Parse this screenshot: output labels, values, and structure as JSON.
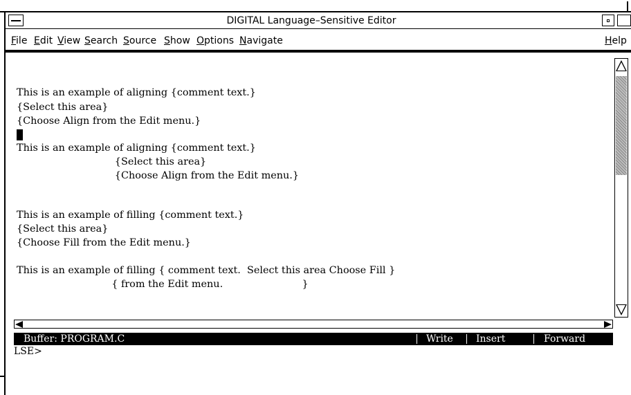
{
  "window": {
    "title": "DIGITAL Language–Sensitive Editor"
  },
  "menubar": {
    "items": [
      "File",
      "Edit",
      "View",
      "Search",
      "Source",
      "Show",
      "Options",
      "Navigate"
    ],
    "help": "Help"
  },
  "editor": {
    "lines": [
      "This is an example of aligning {comment text.}",
      "{Select this area}",
      "{Choose Align from the Edit menu.}",
      "This is an example of aligning {comment text.}",
      "                               {Select this area}",
      "                               {Choose Align from the Edit menu.}",
      "This is an example of filling {comment text.}",
      "{Select this area}",
      "{Choose Fill from the Edit menu.}",
      "This is an example of filling { comment text.  Select this area Choose Fill }",
      "                              { from the Edit menu.                         }"
    ]
  },
  "status": {
    "buffer": "Buffer: PROGRAM.C",
    "write": "Write",
    "insert": "Insert",
    "forward": "Forward"
  },
  "command": {
    "prompt": "LSE>"
  }
}
